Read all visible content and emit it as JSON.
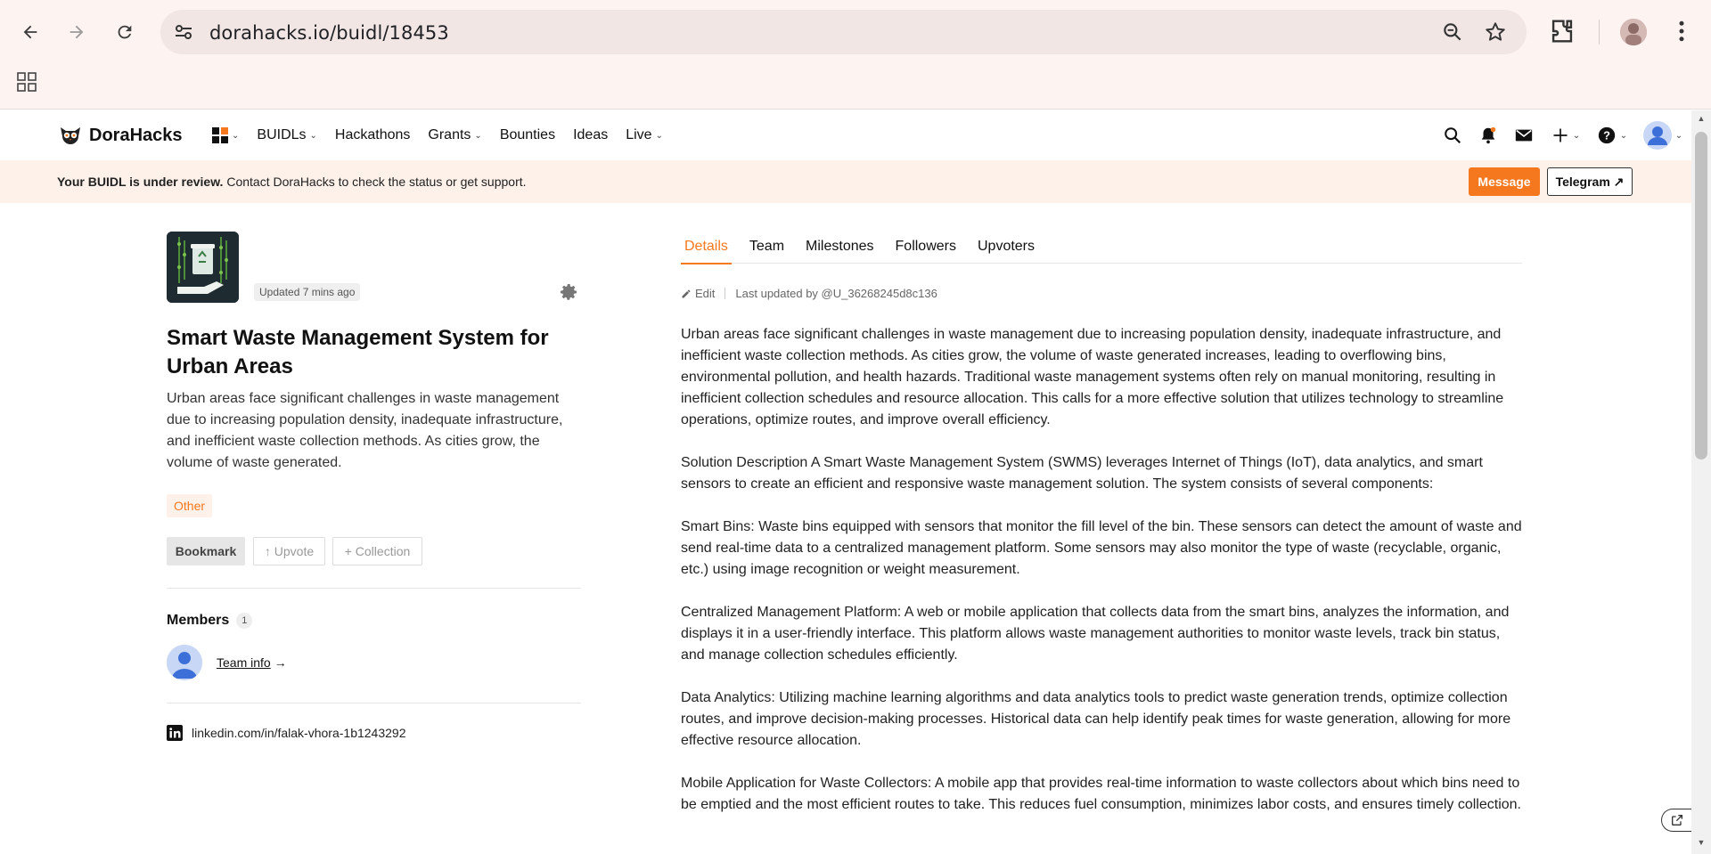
{
  "browser": {
    "url": "dorahacks.io/buidl/18453",
    "icons": [
      "back-icon",
      "forward-icon",
      "reload-icon",
      "site-settings-icon",
      "zoom-icon",
      "bookmark-star-icon",
      "extensions-icon",
      "profile-icon",
      "menu-icon",
      "apps-icon"
    ]
  },
  "header": {
    "logo": "DoraHacks",
    "menu": [
      {
        "label": "BUIDLs"
      },
      {
        "label": "Hackathons"
      },
      {
        "label": "Grants"
      },
      {
        "label": "Bounties"
      },
      {
        "label": "Ideas"
      },
      {
        "label": "Live"
      }
    ]
  },
  "banner": {
    "bold": "Your BUIDL is under review.",
    "text": " Contact DoraHacks to check the status or get support.",
    "message_label": "Message",
    "telegram_label": "Telegram ↗"
  },
  "project": {
    "updated": "Updated 7 mins ago",
    "title": "Smart Waste Management System for Urban Areas",
    "description": "Urban areas face significant challenges in waste management due to increasing population density, inadequate infrastructure, and inefficient waste collection methods. As cities grow, the volume of waste generated.",
    "tag": "Other",
    "bookmark_label": "Bookmark",
    "upvote_label": "↑ Upvote",
    "collection_label": "+ Collection",
    "members_title": "Members",
    "members_count": "1",
    "team_info_label": "Team info",
    "team_info_arrow": " →",
    "linkedin": "linkedin.com/in/falak-vhora-1b1243292"
  },
  "tabs": [
    {
      "label": "Details",
      "active": true
    },
    {
      "label": "Team",
      "active": false
    },
    {
      "label": "Milestones",
      "active": false
    },
    {
      "label": "Followers",
      "active": false
    },
    {
      "label": "Upvoters",
      "active": false
    }
  ],
  "details": {
    "edit_label": "Edit",
    "last_updated": "Last updated by @U_36268245d8c136",
    "paragraphs": [
      "Urban areas face significant challenges in waste management due to increasing population density, inadequate infrastructure, and inefficient waste collection methods. As cities grow, the volume of waste generated increases, leading to overflowing bins, environmental pollution, and health hazards. Traditional waste management systems often rely on manual monitoring, resulting in inefficient collection schedules and resource allocation. This calls for a more effective solution that utilizes technology to streamline operations, optimize routes, and improve overall efficiency.",
      "Solution Description A Smart Waste Management System (SWMS) leverages Internet of Things (IoT), data analytics, and smart sensors to create an efficient and responsive waste management solution. The system consists of several components:",
      "Smart Bins: Waste bins equipped with sensors that monitor the fill level of the bin. These sensors can detect the amount of waste and send real-time data to a centralized management platform. Some sensors may also monitor the type of waste (recyclable, organic, etc.) using image recognition or weight measurement.",
      "Centralized Management Platform: A web or mobile application that collects data from the smart bins, analyzes the information, and displays it in a user-friendly interface. This platform allows waste management authorities to monitor waste levels, track bin status, and manage collection schedules efficiently.",
      "Data Analytics: Utilizing machine learning algorithms and data analytics tools to predict waste generation trends, optimize collection routes, and improve decision-making processes. Historical data can help identify peak times for waste generation, allowing for more effective resource allocation.",
      "Mobile Application for Waste Collectors: A mobile app that provides real-time information to waste collectors about which bins need to be emptied and the most efficient routes to take. This reduces fuel consumption, minimizes labor costs, and ensures timely collection."
    ]
  },
  "colors": {
    "accent": "#f5781e",
    "banner_bg": "#fdf1ea",
    "chrome_bg": "#fdf3f1"
  }
}
